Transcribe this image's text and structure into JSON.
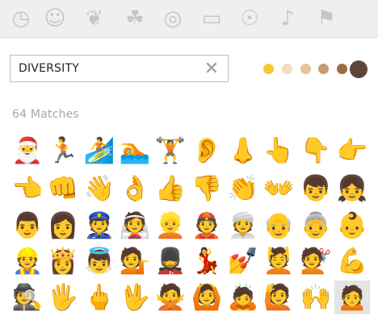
{
  "category_tabs": [
    {
      "name": "recent",
      "icon": "clock-icon",
      "glyph": "◷"
    },
    {
      "name": "smileys",
      "icon": "smiley-icon",
      "glyph": "☺"
    },
    {
      "name": "animals",
      "icon": "dog-face-icon",
      "glyph": "❦"
    },
    {
      "name": "food",
      "icon": "apple-icon",
      "glyph": "☘"
    },
    {
      "name": "activity",
      "icon": "basketball-icon",
      "glyph": "◎"
    },
    {
      "name": "travel",
      "icon": "car-icon",
      "glyph": "▭"
    },
    {
      "name": "objects",
      "icon": "lightbulb-icon",
      "glyph": "☉"
    },
    {
      "name": "symbols",
      "icon": "symbols-icon",
      "glyph": "♪"
    },
    {
      "name": "flags",
      "icon": "flag-icon",
      "glyph": "⚑"
    }
  ],
  "search": {
    "value": "DIVERSITY",
    "clear_icon": "close-icon",
    "clear_glyph": "✕"
  },
  "skin_tones": {
    "selected": 5,
    "colors": [
      "#f8c92c",
      "#f3dcc0",
      "#e6c399",
      "#c99b71",
      "#9b6a43",
      "#5b4638"
    ]
  },
  "results": {
    "label": "64 Matches",
    "selected_index": 49,
    "items": [
      {
        "name": "santa",
        "char": "🎅",
        "color": "#c62828"
      },
      {
        "name": "runner",
        "char": "🏃",
        "color": "#3e2a22"
      },
      {
        "name": "surfer",
        "char": "🏄",
        "color": "#2a8fc4"
      },
      {
        "name": "swimmer",
        "char": "🏊",
        "color": "#2a8fc4"
      },
      {
        "name": "weight-lifter",
        "char": "🏋",
        "color": "#3e2a22"
      },
      {
        "name": "ear",
        "char": "👂",
        "color": "#5a3a28"
      },
      {
        "name": "nose",
        "char": "👃",
        "color": "#5a3a28"
      },
      {
        "name": "pointing-up",
        "char": "👆",
        "color": "#5a3a28"
      },
      {
        "name": "pointing-down",
        "char": "👇",
        "color": "#5a3a28"
      },
      {
        "name": "pointing-right",
        "char": "👉",
        "color": "#5a3a28"
      },
      {
        "name": "pointing-left",
        "char": "👈",
        "color": "#5a3a28"
      },
      {
        "name": "fist",
        "char": "👊",
        "color": "#5a3a28"
      },
      {
        "name": "waving-hand",
        "char": "👋",
        "color": "#5a3a28"
      },
      {
        "name": "ok-hand",
        "char": "👌",
        "color": "#5a3a28"
      },
      {
        "name": "thumbs-up",
        "char": "👍",
        "color": "#5a3a28"
      },
      {
        "name": "thumbs-down",
        "char": "👎",
        "color": "#5a3a28"
      },
      {
        "name": "clapping-hands",
        "char": "👏",
        "color": "#5a3a28"
      },
      {
        "name": "open-hands",
        "char": "👐",
        "color": "#5a3a28"
      },
      {
        "name": "boy",
        "char": "👦",
        "color": "#5a3a28"
      },
      {
        "name": "girl",
        "char": "👧",
        "color": "#5a3a28"
      },
      {
        "name": "man",
        "char": "👨",
        "color": "#5a3a28"
      },
      {
        "name": "woman",
        "char": "👩",
        "color": "#5a3a28"
      },
      {
        "name": "police-officer",
        "char": "👮",
        "color": "#3a5a8a"
      },
      {
        "name": "bride-with-veil",
        "char": "👰",
        "color": "#5a3a28"
      },
      {
        "name": "person-blond-hair",
        "char": "👱",
        "color": "#d9a441"
      },
      {
        "name": "man-with-cap",
        "char": "👲",
        "color": "#c0392b"
      },
      {
        "name": "man-with-turban",
        "char": "👳",
        "color": "#2a8fc4"
      },
      {
        "name": "old-man",
        "char": "👴",
        "color": "#5a3a28"
      },
      {
        "name": "old-woman",
        "char": "👵",
        "color": "#5a3a28"
      },
      {
        "name": "baby",
        "char": "👶",
        "color": "#2a8fc4"
      },
      {
        "name": "construction-worker",
        "char": "👷",
        "color": "#e67e22"
      },
      {
        "name": "princess",
        "char": "👸",
        "color": "#5a3a28"
      },
      {
        "name": "angel",
        "char": "👼",
        "color": "#5a3a28"
      },
      {
        "name": "person-tipping-hand",
        "char": "💁",
        "color": "#8e5bb8"
      },
      {
        "name": "guard",
        "char": "💂",
        "color": "#3e2a22"
      },
      {
        "name": "dancer",
        "char": "💃",
        "color": "#d9342b"
      },
      {
        "name": "nail-polish",
        "char": "💅",
        "color": "#c0392b"
      },
      {
        "name": "person-getting-massage",
        "char": "💆",
        "color": "#8e5bb8"
      },
      {
        "name": "person-getting-haircut",
        "char": "💇",
        "color": "#8e5bb8"
      },
      {
        "name": "flexed-biceps",
        "char": "💪",
        "color": "#5a3a28"
      },
      {
        "name": "detective",
        "char": "🕵",
        "color": "#4a4a4a"
      },
      {
        "name": "raised-hand-fingers-splayed",
        "char": "🖐",
        "color": "#5a3a28"
      },
      {
        "name": "middle-finger",
        "char": "🖕",
        "color": "#5a3a28"
      },
      {
        "name": "vulcan-salute",
        "char": "🖖",
        "color": "#5a3a28"
      },
      {
        "name": "person-gesturing-no",
        "char": "🙅",
        "color": "#8e5bb8"
      },
      {
        "name": "person-gesturing-ok",
        "char": "🙆",
        "color": "#8e5bb8"
      },
      {
        "name": "person-bowing",
        "char": "🙇",
        "color": "#2a6fa8"
      },
      {
        "name": "person-raising-hand",
        "char": "🙋",
        "color": "#8e5bb8"
      },
      {
        "name": "raising-hands",
        "char": "🙌",
        "color": "#5a3a28"
      },
      {
        "name": "person-frowning",
        "char": "🙍",
        "color": "#8e5bb8"
      }
    ]
  }
}
